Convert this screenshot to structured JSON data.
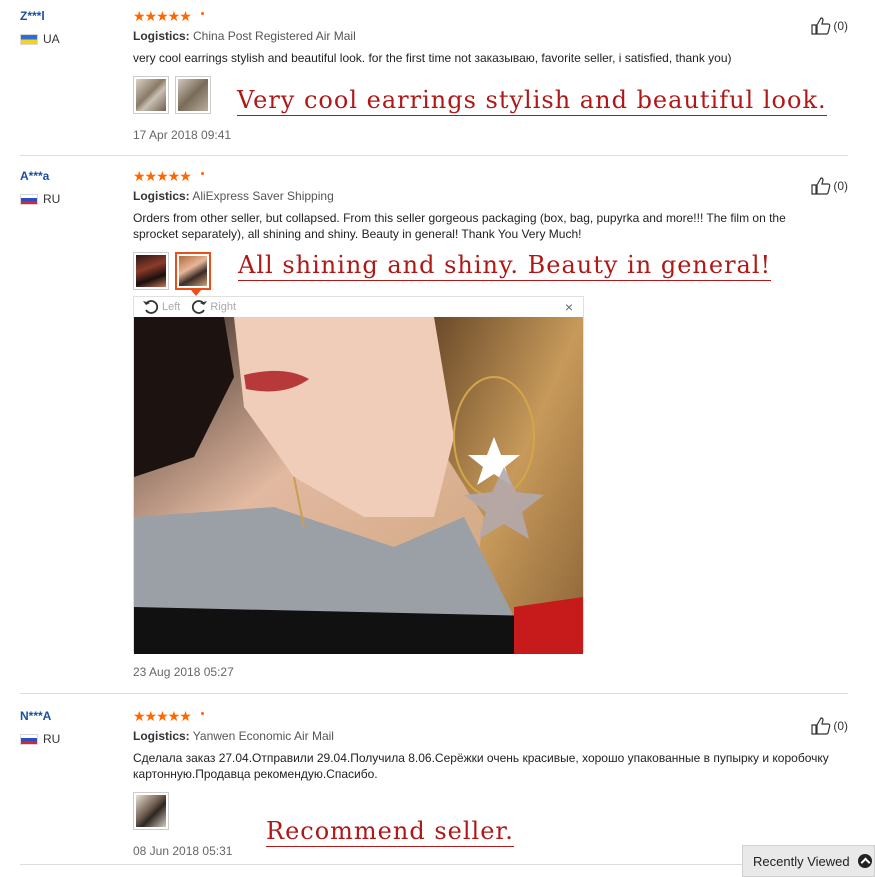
{
  "reviews": [
    {
      "user": "Z***l",
      "country_code": "UA",
      "rating": 5,
      "logistics_label": "Logistics:",
      "logistics_value": "China Post Registered Air Mail",
      "text": "very cool earrings stylish and beautiful look. for the first time not заказываю, favorite seller, i satisfied, thank you)",
      "likes": "(0)",
      "caption": "Very cool earrings stylish and beautiful look.",
      "date": "17 Apr 2018 09:41"
    },
    {
      "user": "A***a",
      "country_code": "RU",
      "rating": 5,
      "logistics_label": "Logistics:",
      "logistics_value": "AliExpress Saver Shipping",
      "text": "Orders from other seller, but collapsed. From this seller gorgeous packaging (box, bag, pupyrka and more!!! The film on the sprocket separately), all shining and shiny. Beauty in general! Thank You Very Much!",
      "likes": "(0)",
      "caption": "All shining and shiny. Beauty in general!",
      "date": "23 Aug 2018 05:27"
    },
    {
      "user": "N***A",
      "country_code": "RU",
      "rating": 5,
      "logistics_label": "Logistics:",
      "logistics_value": "Yanwen Economic Air Mail",
      "text": "Сделала заказ 27.04.Отправили 29.04.Получила 8.06.Серёжки очень красивые, хорошо упакованные в пупырку и коробочку картонную.Продавца рекомендую.Спасибо.",
      "likes": "(0)",
      "caption": "Recommend seller.",
      "date": "08 Jun 2018 05:31"
    }
  ],
  "viewer": {
    "rotate_left": "Left",
    "rotate_right": "Right",
    "close": "×"
  },
  "recently_viewed": "Recently Viewed",
  "colors": {
    "star": "#ff6600",
    "caption": "#b01818",
    "username": "#1a4fa0",
    "active_thumb": "#e94e1b"
  }
}
